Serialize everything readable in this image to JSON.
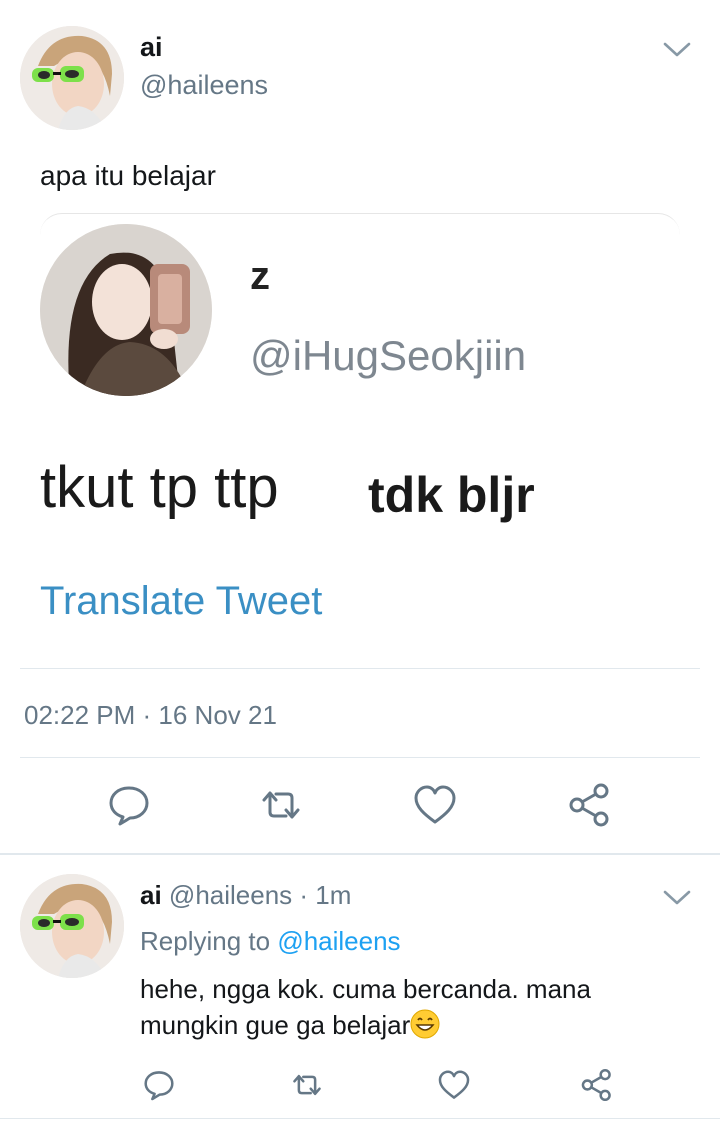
{
  "tweet": {
    "display_name": "ai",
    "handle": "@haileens",
    "text": "apa itu belajar",
    "timestamp": "02:22 PM · 16 Nov 21"
  },
  "embedded": {
    "display_name": "z",
    "handle": "@iHugSeokjiin",
    "text_part1": "tkut tp ttp",
    "text_part2": "tdk bljr",
    "translate_label": "Translate Tweet"
  },
  "reply": {
    "display_name": "ai",
    "handle_time": "@haileens · 1m",
    "replying_prefix": "Replying to",
    "replying_mention": "@haileens",
    "text": "hehe, ngga kok. cuma bercanda. mana mungkin gue ga belajar"
  },
  "icons": {
    "reply": "reply-icon",
    "retweet": "retweet-icon",
    "like": "heart-icon",
    "share": "share-icon",
    "menu": "chevron-down-icon"
  },
  "colors": {
    "text": "#14171a",
    "secondary": "#657786",
    "accent": "#1da1f2",
    "translate": "#3a8fc4"
  }
}
